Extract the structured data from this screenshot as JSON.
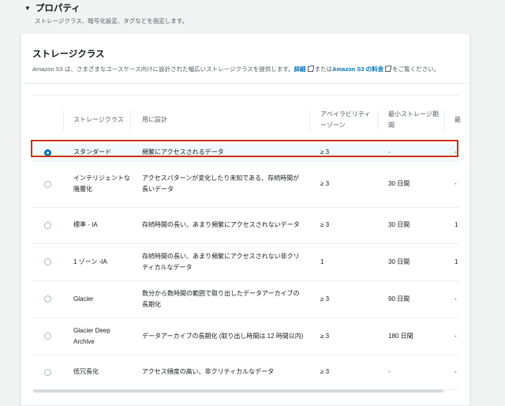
{
  "properties": {
    "title": "プロパティ",
    "subtitle": "ストレージクラス、暗号化設定、タグなどを指定します。"
  },
  "storage_class": {
    "title": "ストレージクラス",
    "description_prefix": "Amazon S3 は、さまざまなユースケース向けに設計された幅広いストレージクラスを提供します。",
    "details_link": "詳細",
    "middle_text": "または",
    "pricing_link": "Amazon S3 の料金",
    "description_suffix": "をご覧ください。"
  },
  "table": {
    "headers": {
      "class": "ストレージクラス",
      "designed_for": "用に設計",
      "az": "アベイラビリティーゾーン",
      "min_duration": "最小ストレージ期間",
      "next": "最"
    },
    "rows": [
      {
        "name": "スタンダード",
        "designed_for": "頻繁にアクセスされるデータ",
        "az": "≥ 3",
        "min_duration": "-",
        "next": "-",
        "selected": true
      },
      {
        "name": "インテリジェントな階層化",
        "designed_for": "アクセスパターンが変化したり未知である、存続時間が長いデータ",
        "az": "≥ 3",
        "min_duration": "30 日間",
        "next": "-",
        "selected": false
      },
      {
        "name": "標準 - IA",
        "designed_for": "存続時間の長い、あまり頻繁にアクセスされないデータ",
        "az": "≥ 3",
        "min_duration": "30 日間",
        "next": "1",
        "selected": false
      },
      {
        "name": "1 ゾーン -IA",
        "designed_for": "存続時間の長い、あまり頻繁にアクセスされない非クリティカルなデータ",
        "az": "1",
        "min_duration": "30 日間",
        "next": "1",
        "selected": false
      },
      {
        "name": "Glacier",
        "designed_for": "数分から数時間の範囲で取り出したデータアーカイブの長期化",
        "az": "≥ 3",
        "min_duration": "90 日間",
        "next": "-",
        "selected": false
      },
      {
        "name": "Glacier Deep Archive",
        "designed_for": "データアーカイブの長期化 (取り出し時間は 12 時間以内)",
        "az": "≥ 3",
        "min_duration": "180 日間",
        "next": "-",
        "selected": false
      },
      {
        "name": "低冗長化",
        "designed_for": "アクセス頻度の高い、非クリティカルなデータ",
        "az": "≥ 3",
        "min_duration": "-",
        "next": "-",
        "selected": false
      }
    ]
  },
  "colors": {
    "link": "#0073bb",
    "selected_outline": "#d13212",
    "radio_checked": "#0073bb"
  }
}
